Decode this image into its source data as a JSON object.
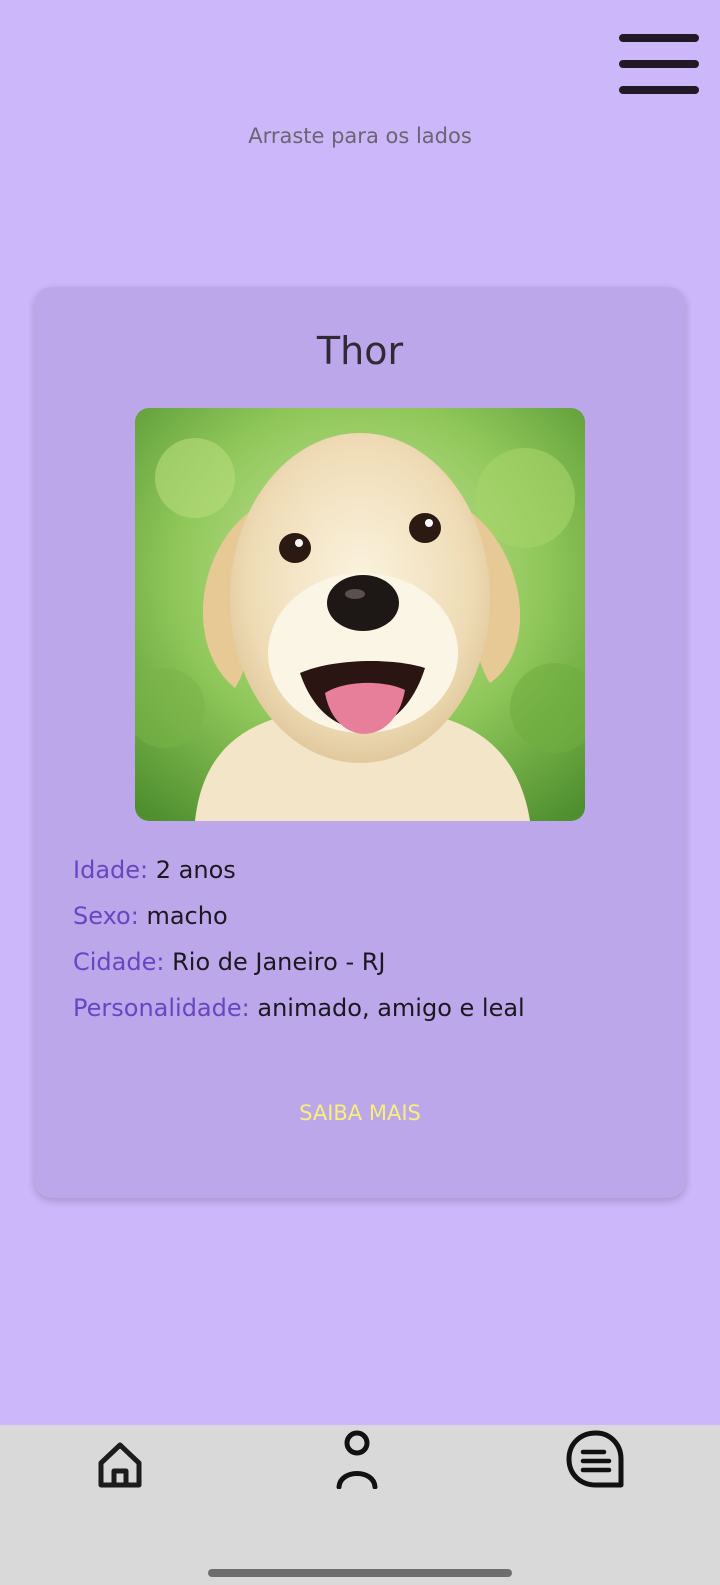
{
  "header": {
    "menu_icon": "hamburger-menu-icon",
    "hint": "Arraste para os lados"
  },
  "pet_card": {
    "name": "Thor",
    "photo": "puppy-photo",
    "details": [
      {
        "label": "Idade:",
        "value": "2 anos"
      },
      {
        "label": "Sexo:",
        "value": "macho"
      },
      {
        "label": "Cidade:",
        "value": "Rio de Janeiro - RJ"
      },
      {
        "label": "Personalidade:",
        "value": "animado, amigo e leal"
      }
    ],
    "more_label": "SAIBA MAIS"
  },
  "bottom_nav": {
    "items": [
      {
        "icon": "home-icon"
      },
      {
        "icon": "profile-icon"
      },
      {
        "icon": "chat-icon"
      }
    ]
  },
  "colors": {
    "background": "#cbb7f9",
    "card": "#bca7ea",
    "label": "#6a45c2",
    "button_text": "#f8f07a",
    "nav_bar": "#d9d9d9"
  }
}
